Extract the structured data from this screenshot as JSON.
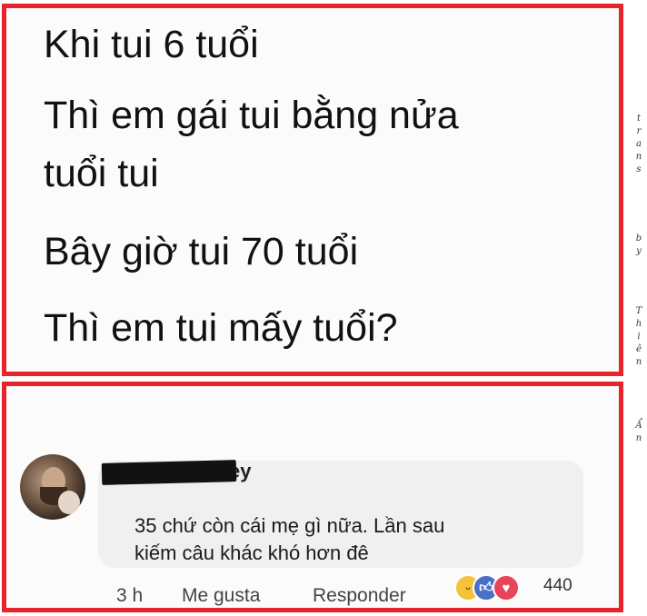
{
  "post": {
    "lines": [
      "Khi tui 6 tuổi",
      "Thì em gái tui bằng nửa",
      "tuổi tui",
      "Bây giờ tui 70 tuổi",
      "Thì em tui mấy tuổi?"
    ]
  },
  "watermark": {
    "trans": [
      "t",
      "r",
      "a",
      "n",
      "s"
    ],
    "by": [
      "b",
      "y"
    ],
    "thien": [
      "T",
      "h",
      "i",
      "ê",
      "n"
    ],
    "an": [
      "Ẩ",
      "n"
    ]
  },
  "comment": {
    "name_tail": "ey",
    "lines": [
      "35 chứ còn cái mẹ gì nữa. Lần sau",
      "kiếm câu khác khó hơn đê"
    ],
    "time": "3 h",
    "like_label": "Me gusta",
    "reply_label": "Responder",
    "reaction_count": "440",
    "reactions": [
      "haha-icon",
      "like-icon",
      "love-icon"
    ]
  },
  "colors": {
    "frame": "#e8232c",
    "bubble": "#f0f0f0",
    "like": "#4a6fc7",
    "love": "#e8445a",
    "haha": "#f5c33b"
  }
}
